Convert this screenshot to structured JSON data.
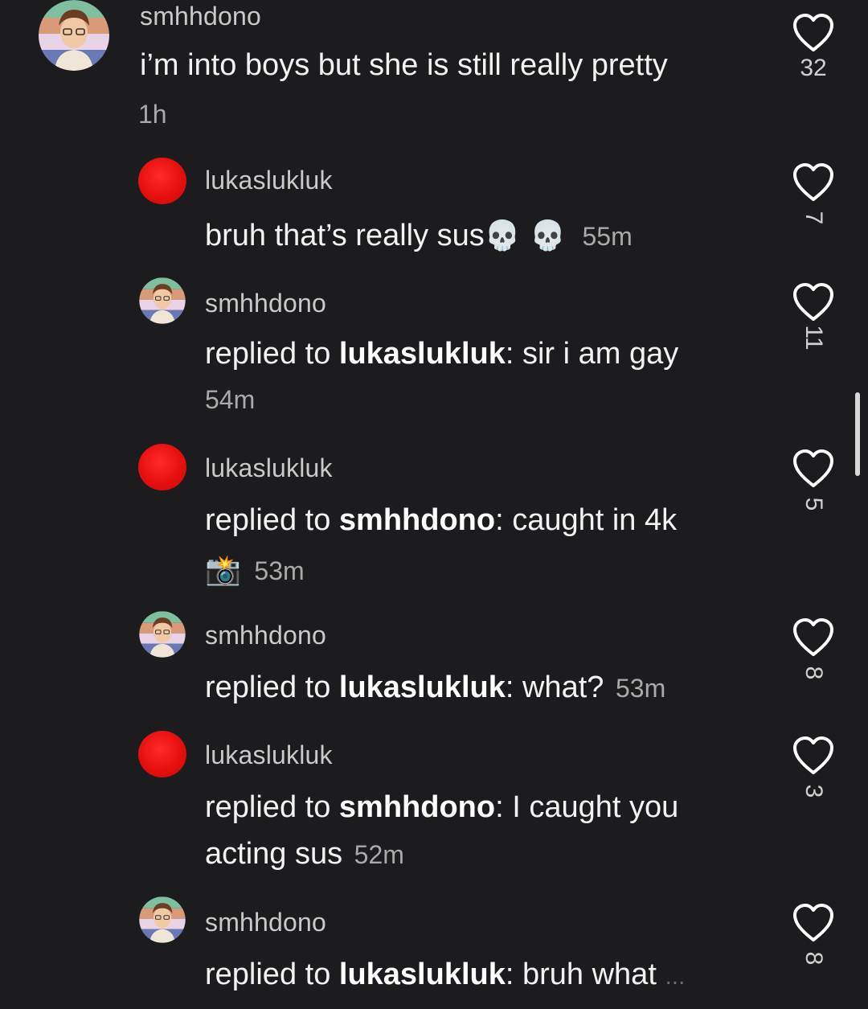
{
  "colors": {
    "background": "#1c1c1e",
    "red_avatar": "#e60f0f",
    "heart": "#ffffff"
  },
  "comments": [
    {
      "username": "smhhdono",
      "text": "i’m into boys but she is still really pretty",
      "time": "1h",
      "likes": "32",
      "avatar": "cartoon-avatar"
    },
    {
      "username": "lukaslukluk",
      "text": "bruh that’s really sus",
      "emoji": "💀 💀",
      "time": "55m",
      "likes": "7",
      "avatar": "red-dot"
    },
    {
      "username": "smhhdono",
      "prefix": "replied to ",
      "mention": "lukaslukluk",
      "text": ": sir i am gay",
      "time": "54m",
      "likes": "11",
      "avatar": "cartoon-avatar"
    },
    {
      "username": "lukaslukluk",
      "prefix": "replied to ",
      "mention": "smhhdono",
      "text": ": caught in 4k",
      "emoji": "📸",
      "time": "53m",
      "likes": "5",
      "avatar": "red-dot"
    },
    {
      "username": "smhhdono",
      "prefix": "replied to ",
      "mention": "lukaslukluk",
      "text": ": what?",
      "time": "53m",
      "likes": "8",
      "avatar": "cartoon-avatar"
    },
    {
      "username": "lukaslukluk",
      "prefix": "replied to ",
      "mention": "smhhdono",
      "text": ": I caught you",
      "text2": "acting sus",
      "time": "52m",
      "likes": "3",
      "avatar": "red-dot"
    },
    {
      "username": "smhhdono",
      "prefix": "replied to ",
      "mention": "lukaslukluk",
      "text": ": bruh what",
      "ellipsis": "...",
      "likes": "8",
      "avatar": "cartoon-avatar"
    }
  ],
  "icons": {
    "like": "heart-outline-icon",
    "scroll": "scrollbar"
  }
}
